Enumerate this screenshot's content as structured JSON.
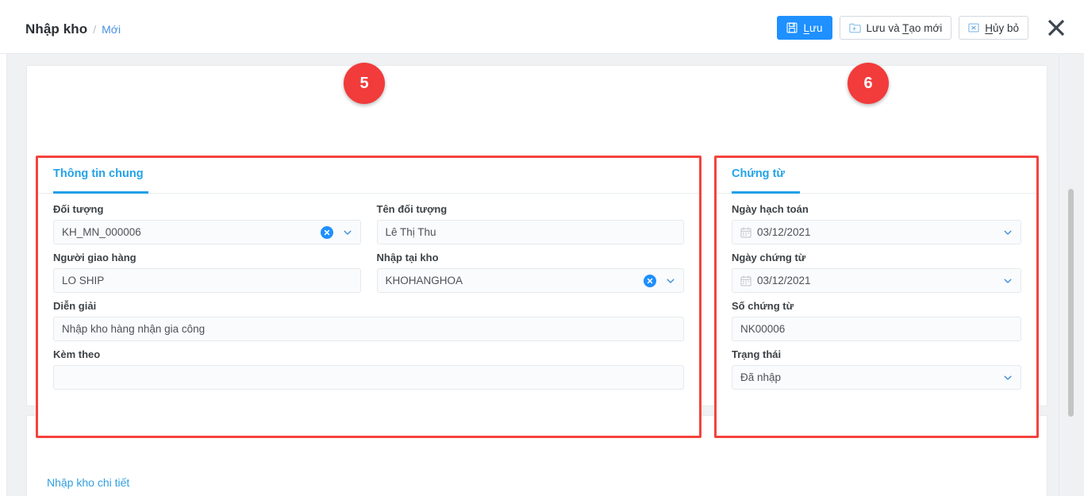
{
  "header": {
    "breadcrumb": {
      "root": "Nhập kho",
      "separator": "/",
      "current": "Mới"
    },
    "buttons": {
      "save": {
        "label_pre": "",
        "label_accel": "L",
        "label_post": "ưu",
        "label_full": "Lưu",
        "icon": "save-floppy-icon"
      },
      "save_and_new": {
        "label_pre": "Lưu và ",
        "label_accel": "T",
        "label_post": "ạo mới",
        "label_full": "Lưu và Tạo mới",
        "icon": "folder-plus-icon"
      },
      "cancel": {
        "label_pre": "",
        "label_accel": "H",
        "label_post": "ủy bỏ",
        "label_full": "Hủy bỏ",
        "icon": "boxed-x-icon"
      },
      "close": {
        "label": "",
        "icon": "close-x-icon"
      }
    }
  },
  "badges": [
    {
      "number": "5",
      "target": "thong-tin-chung-panel"
    },
    {
      "number": "6",
      "target": "chung-tu-panel"
    }
  ],
  "panels": {
    "general": {
      "tab_label": "Thông tin chung",
      "fields": {
        "doi_tuong": {
          "label": "Đối tượng",
          "value": "KH_MN_000006",
          "has_clear": true,
          "has_chevron": true
        },
        "ten_doi_tuong": {
          "label": "Tên đối tượng",
          "value": "Lê Thị Thu",
          "has_clear": false,
          "has_chevron": false
        },
        "nguoi_giao_hang": {
          "label": "Người giao hàng",
          "value": "LO SHIP",
          "has_clear": false,
          "has_chevron": false
        },
        "nhap_tai_kho": {
          "label": "Nhập tại kho",
          "value": "KHOHANGHOA",
          "has_clear": true,
          "has_chevron": true
        },
        "dien_giai": {
          "label": "Diễn giải",
          "value": "Nhập kho hàng nhận gia công",
          "has_clear": false,
          "has_chevron": false
        },
        "kem_theo": {
          "label": "Kèm theo",
          "value": "",
          "has_clear": false,
          "has_chevron": false
        }
      }
    },
    "document": {
      "tab_label": "Chứng từ",
      "fields": {
        "ngay_hach_toan": {
          "label": "Ngày hạch toán",
          "value": "03/12/2021",
          "icon": "calendar-icon",
          "has_chevron": true
        },
        "ngay_chung_tu": {
          "label": "Ngày chứng từ",
          "value": "03/12/2021",
          "icon": "calendar-icon",
          "has_chevron": true
        },
        "so_chung_tu": {
          "label": "Số chứng từ",
          "value": "NK00006",
          "icon": "",
          "has_chevron": false
        },
        "trang_thai": {
          "label": "Trạng thái",
          "value": "Đã nhập",
          "icon": "",
          "has_chevron": true
        }
      }
    }
  },
  "bottom_section": {
    "tab_label": "Nhập kho chi tiết"
  },
  "colors": {
    "accent_blue": "#1e90ff",
    "tab_blue": "#21a0e8",
    "highlight_red": "#f4433d",
    "badge_red": "#f23b3b",
    "page_bg": "#f0f1f3"
  }
}
